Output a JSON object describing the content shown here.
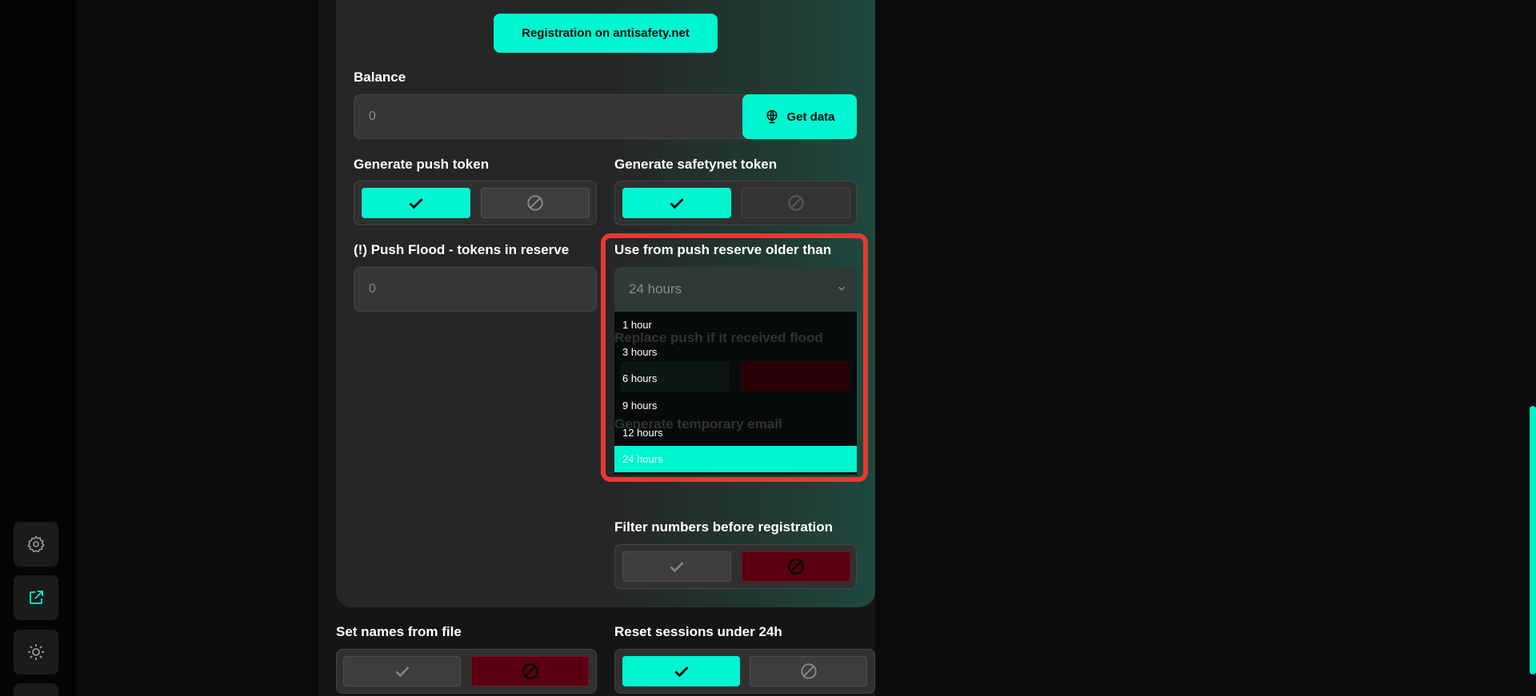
{
  "registration_button": "Registration on antisafety.net",
  "balance": {
    "label": "Balance",
    "value": "0",
    "get_data_label": "Get data"
  },
  "generate_push_token": {
    "label": "Generate push token"
  },
  "generate_safetynet_token": {
    "label": "Generate safetynet token"
  },
  "push_flood": {
    "label": "(!) Push Flood - tokens in reserve",
    "value": "0"
  },
  "use_from_push_reserve": {
    "label": "Use from push reserve older than",
    "selected": "24 hours",
    "options": [
      "1 hour",
      "3 hours",
      "6 hours",
      "9 hours",
      "12 hours",
      "24 hours"
    ]
  },
  "replace_push_label": "Replace push if it received flood",
  "generate_temp_email_label": "Generate temporary email",
  "filter_numbers": {
    "label": "Filter numbers before registration"
  },
  "set_names_from_file": {
    "label": "Set names from file"
  },
  "reset_sessions": {
    "label": "Reset sessions under 24h"
  },
  "colors": {
    "accent": "#00f5d0",
    "danger": "#5a0010",
    "highlight": "#e53935"
  },
  "sidebar_icons": [
    "gear-icon",
    "external-link-icon",
    "sun-icon"
  ]
}
